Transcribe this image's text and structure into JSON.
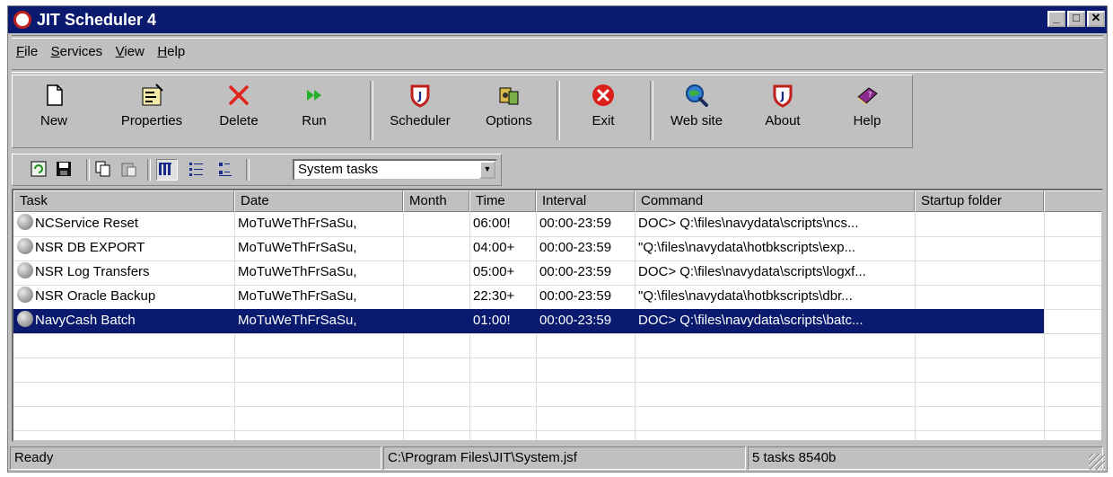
{
  "window": {
    "title": "JIT Scheduler 4"
  },
  "menu": [
    {
      "label": "File",
      "hotkey": "F"
    },
    {
      "label": "Services",
      "hotkey": "S"
    },
    {
      "label": "View",
      "hotkey": "V"
    },
    {
      "label": "Help",
      "hotkey": "H"
    }
  ],
  "toolbar": {
    "new": "New",
    "properties": "Properties",
    "delete": "Delete",
    "run": "Run",
    "scheduler": "Scheduler",
    "options": "Options",
    "exit": "Exit",
    "website": "Web site",
    "about": "About",
    "help": "Help"
  },
  "filter": {
    "selected": "System tasks"
  },
  "table": {
    "columns": [
      "Task",
      "Date",
      "Month",
      "Time",
      "Interval",
      "Command",
      "Startup folder"
    ],
    "rows": [
      {
        "task": "NCService Reset",
        "date": "MoTuWeThFrSaSu,",
        "month": "",
        "time": "06:00!",
        "interval": "00:00-23:59",
        "command": "DOC> Q:\\files\\navydata\\scripts\\ncs...",
        "folder": ""
      },
      {
        "task": "NSR DB EXPORT",
        "date": "MoTuWeThFrSaSu,",
        "month": "",
        "time": "04:00+",
        "interval": "00:00-23:59",
        "command": "\"Q:\\files\\navydata\\hotbkscripts\\exp...",
        "folder": ""
      },
      {
        "task": "NSR Log Transfers",
        "date": "MoTuWeThFrSaSu,",
        "month": "",
        "time": "05:00+",
        "interval": "00:00-23:59",
        "command": "DOC> Q:\\files\\navydata\\scripts\\logxf...",
        "folder": ""
      },
      {
        "task": "NSR Oracle Backup",
        "date": "MoTuWeThFrSaSu,",
        "month": "",
        "time": "22:30+",
        "interval": "00:00-23:59",
        "command": "\"Q:\\files\\navydata\\hotbkscripts\\dbr...",
        "folder": ""
      },
      {
        "task": "NavyCash Batch",
        "date": "MoTuWeThFrSaSu,",
        "month": "",
        "time": "01:00!",
        "interval": "00:00-23:59",
        "command": "DOC> Q:\\files\\navydata\\scripts\\batc...",
        "folder": ""
      }
    ],
    "selected_row": 4
  },
  "status": {
    "state": "Ready",
    "path": "C:\\Program Files\\JIT\\System.jsf",
    "summary": "5 tasks  8540b"
  },
  "colors": {
    "titlebar": "#0a1a6e",
    "chrome": "#c0c0c0",
    "selection": "#0a1a6e"
  }
}
